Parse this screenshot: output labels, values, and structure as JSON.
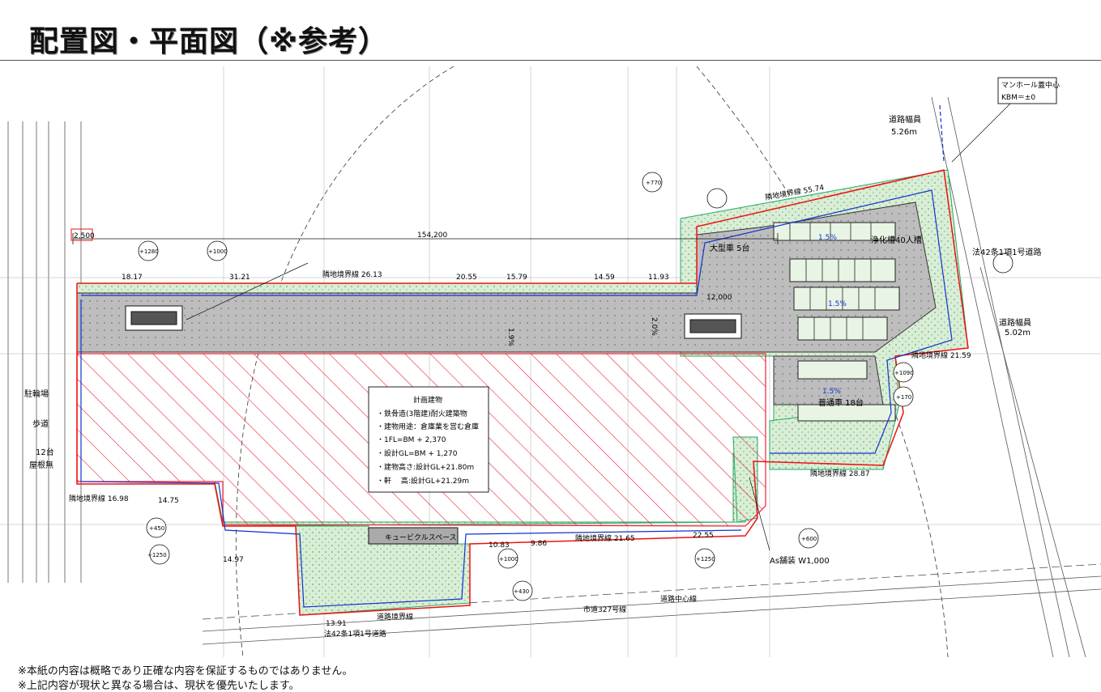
{
  "header": {
    "title": "配置図・平面図（※参考）"
  },
  "footer": {
    "note1": "※本紙の内容は概略であり正確な内容を保証するものではありません。",
    "note2": "※上記内容が現状と異なる場合は、現状を優先いたします。"
  },
  "plan": {
    "info_box": {
      "title": "計画建物",
      "line1": "・鉄骨造(3階建)耐火建築物",
      "line2": "・建物用途：倉庫業を営む倉庫",
      "line3": "・1FL=BM + 2,370",
      "line4": "・設計GL=BM + 1,270",
      "line5": "・建物高さ:設計GL+21.80m",
      "line6": "・軒　 高:設計GL+21.29m"
    },
    "manhole": {
      "line1": "マンホール蓋中心",
      "line2": "KBM＝±0"
    },
    "road_width_top": {
      "label": "道路幅員",
      "value": "5.26m"
    },
    "road_width_right": {
      "label": "道路幅員",
      "value": "5.02m"
    },
    "road_right": "法42条1項1号道路",
    "road_bottom": "法42条1項1号道路",
    "city_road": "市道327号線",
    "road_center": "道路中心線",
    "as_paving": "As舗装 W1,000",
    "cubicle": "キュービクルスペース",
    "dimension_total": "154,200",
    "dimension_left": "2,500",
    "dimension_12000": "12,000",
    "parking": {
      "large": "大型車 5台",
      "small": "普通車 18台",
      "septic": "浄化槽40人槽",
      "left_count": "12台",
      "left_roof": "屋根無",
      "left_walk": "歩道",
      "left_bike": "駐輪場"
    },
    "boundaries": {
      "b1": "隣地境界線 55.74",
      "b2": "隣地境界線 26.13",
      "b3": "隣地境界線 21.59",
      "b4": "隣地境界線 28.87",
      "b5": "隣地境界線 21.65",
      "b6": "隣地境界線 16.98",
      "b7": "道路境界線"
    },
    "segments": [
      "31.21",
      "20.55",
      "15.79",
      "14.59",
      "11.93",
      "18.17",
      "14.75",
      "14.97",
      "10.83",
      "9.86",
      "22.55",
      "13.91"
    ],
    "levels": [
      "+1280",
      "+1000",
      "+770",
      "+1090",
      "+170",
      "+1250",
      "+1000",
      "+1250",
      "+600",
      "+450",
      "+430"
    ],
    "slopes": [
      "1.5%",
      "1.5%",
      "1.5%",
      "1.9%",
      "2.0%"
    ]
  }
}
